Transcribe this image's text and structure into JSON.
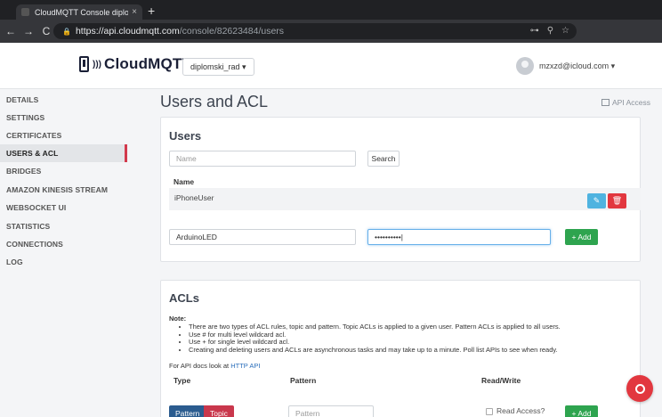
{
  "browser": {
    "tab_title": "CloudMQTT Console diplomski",
    "tab_close": "×",
    "new_tab": "+",
    "url_domain": "https://api.cloudmqtt.com",
    "url_path": "/console/82623484/users",
    "back": "←",
    "forward": "→",
    "reload": "C",
    "lock": "🔒",
    "key_icon": "⊶",
    "zoom_icon": "⚲",
    "star_icon": "☆"
  },
  "header": {
    "brand": "CloudMQTT",
    "instance": "diplomski_rad ▾",
    "user_email": "mzxzd@icloud.com ▾"
  },
  "sidebar": {
    "items": [
      {
        "label": "DETAILS"
      },
      {
        "label": "SETTINGS"
      },
      {
        "label": "CERTIFICATES"
      },
      {
        "label": "USERS & ACL"
      },
      {
        "label": "BRIDGES"
      },
      {
        "label": "AMAZON KINESIS STREAM"
      },
      {
        "label": "WEBSOCKET UI"
      },
      {
        "label": "STATISTICS"
      },
      {
        "label": "CONNECTIONS"
      },
      {
        "label": "LOG"
      }
    ],
    "active_index": 3
  },
  "page": {
    "title": "Users and ACL",
    "api_access": "API Access"
  },
  "users": {
    "title": "Users",
    "search_placeholder": "Name",
    "search_button": "Search",
    "column_name": "Name",
    "rows": [
      {
        "name": "iPhoneUser"
      }
    ],
    "edit_icon": "✎",
    "delete_icon": "🗑",
    "new_username": "ArduinoLED",
    "new_password": "••••••••••|",
    "add_button": "+ Add"
  },
  "acls": {
    "title": "ACLs",
    "note_label": "Note:",
    "notes": [
      "There are two types of ACL rules, topic and pattern. Topic ACLs is applied to a given user. Pattern ACLs is applied to all users.",
      "Use # for multi level wildcard acl.",
      "Use + for single level wildcard acl.",
      "Creating and deleting users and ACLs are asynchronous tasks and may take up to a minute. Poll list APIs to see when ready."
    ],
    "api_docs_prefix": "For API docs look at ",
    "api_docs_link": "HTTP API",
    "col_type": "Type",
    "col_pattern": "Pattern",
    "col_rw": "Read/Write",
    "seg_pattern": "Pattern",
    "seg_topic": "Topic",
    "pattern_placeholder": "Pattern",
    "read_access_label": "Read Access?",
    "add_button": "+ Add"
  },
  "colors": {
    "accent_red": "#d2394c",
    "add_green": "#2ea44f",
    "edit_blue": "#4fb3e0",
    "delete_red": "#e2373f",
    "segment_blue": "#2b5c8f",
    "segment_red": "#c9374c"
  }
}
